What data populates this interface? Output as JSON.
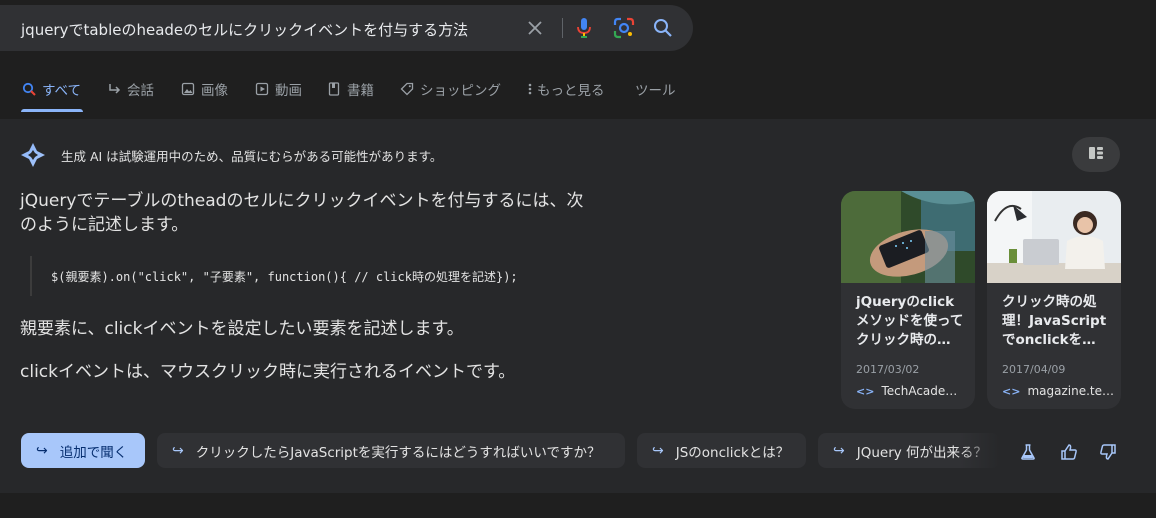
{
  "search": {
    "query": "jqueryでtableのheadeのセルにクリックイベントを付与する方法",
    "clear_icon": "close-icon",
    "voice_icon": "mic-icon",
    "lens_icon": "lens-icon",
    "search_icon": "search-icon"
  },
  "tabs": [
    {
      "label": "すべて",
      "icon": "search-icon",
      "active": true
    },
    {
      "label": "会話",
      "icon": "arrow-icon"
    },
    {
      "label": "画像",
      "icon": "image-icon"
    },
    {
      "label": "動画",
      "icon": "video-icon"
    },
    {
      "label": "書籍",
      "icon": "book-icon"
    },
    {
      "label": "ショッピング",
      "icon": "tag-icon"
    },
    {
      "label": "もっと見る",
      "icon": "more-vert-icon"
    },
    {
      "label": "ツール",
      "icon": ""
    }
  ],
  "ai": {
    "disclaimer": "生成 AI は試験運用中のため、品質にむらがある可能性があります。",
    "answer_line1": "jQueryでテーブルのtheadのセルにクリックイベントを付与するには、次",
    "answer_line2": "のように記述します。",
    "code": "$(親要素).on(\"click\", \"子要素\", function(){ // click時の処理を記述});",
    "para1": "親要素に、clickイベントを設定したい要素を記述します。",
    "para2": "clickイベントは、マウスクリック時に実行されるイベントです。"
  },
  "cards": [
    {
      "title": "jQueryのclickメソッドを使ってクリック時の…",
      "date": "2017/03/02",
      "source": "TechAcade…"
    },
    {
      "title": "クリック時の処理！JavaScriptでonclickを…",
      "date": "2017/04/09",
      "source": "magazine.te…"
    }
  ],
  "chips": [
    {
      "label": "追加で聞く",
      "primary": true
    },
    {
      "label": "クリックしたらJavaScriptを実行するにはどうすればいいですか？"
    },
    {
      "label": "JSのonclickとは？"
    },
    {
      "label": "JQuery 何が出来る？"
    }
  ],
  "feedback_icons": [
    "flask-icon",
    "thumbs-up-icon",
    "thumbs-down-icon"
  ],
  "colors": {
    "accent": "#8ab4f8",
    "chip_primary": "#a8c7fa",
    "panel": "#27282a",
    "background": "#1f1f1f"
  }
}
